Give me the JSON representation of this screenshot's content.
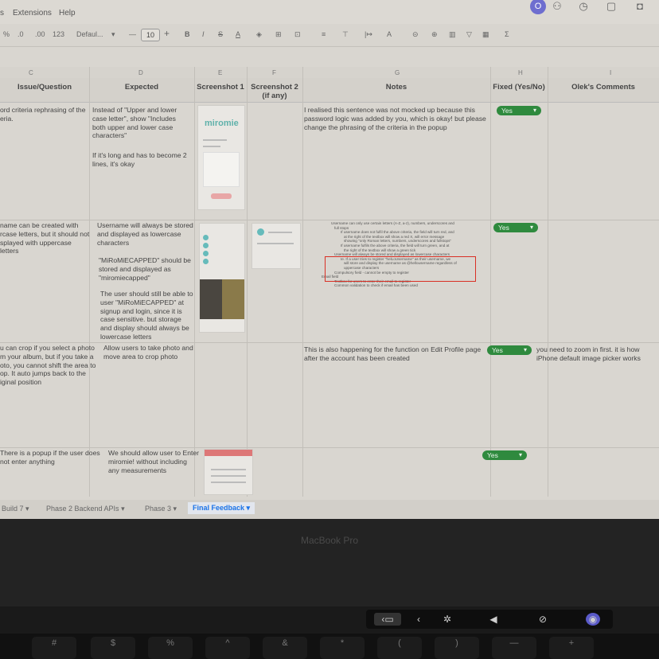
{
  "menu": {
    "extensions": "Extensions",
    "help": "Help",
    "partial": "s"
  },
  "header_icons": {
    "avatar_letter": "O"
  },
  "toolbar": {
    "percent": "%",
    "dec_less": ".0",
    "dec_more": ".00",
    "num_format": "123",
    "font": "Defaul...",
    "minus": "—",
    "font_size": "10",
    "plus": "+",
    "bold": "B",
    "italic": "I",
    "strike": "S",
    "color_a": "A",
    "sigma": "Σ"
  },
  "col_letters": [
    "C",
    "D",
    "E",
    "F",
    "G",
    "H",
    "I"
  ],
  "columns": {
    "issue": "Issue/Question",
    "expected": "Expected",
    "shot1": "Screenshot 1",
    "shot2": "Screenshot 2 (if any)",
    "notes": "Notes",
    "fixed": "Fixed (Yes/No)",
    "comments": "Olek's Comments"
  },
  "rows": [
    {
      "issue": "ord criteria rephrasing of the eria.",
      "expected": "Instead of \"Upper and lower case letter\", show \"Includes both upper and lower case characters\"",
      "expected2": "If it's long and has to become 2 lines, it's okay",
      "shot1_logo": "miromie",
      "notes": "I realised this sentence was not mocked up because this password logic was added by you, which is okay! but please change the phrasing of the criteria in the popup",
      "fixed": "Yes",
      "comment": ""
    },
    {
      "issue": "name can be created with rcase letters, but it should not splayed with uppercase letters",
      "expected": "Username will always be stored and displayed as lowercase characters",
      "expected2": "\"MiRoMiECAPPED\" should be stored and displayed as \"miromiecapped\"",
      "expected3": "The user should still be able to user \"MiRoMiECAPPED\" at signup and login, since it is case sensitive. but storage and display should always be lowercase letters",
      "notes_lines": [
        "Username can only use certain letters (A-Z, a-z), numbers, underscores and",
        "full stops",
        "If username does not fulfil the above criteria, the field will turn red, and",
        "at the right of the textbox will show a red X, will error message",
        "showing \"only Roman letters, numbers, underscores and fullstops\"",
        "If username fulfils the above criteria, the field will turn green, and at",
        "the right of the textbox will show a green tick",
        "Username will always be stored and displayed as lowercase characters",
        "Ie. If a user tries to register \"helLoUsername\" as their username, we",
        "will store and display the username as @hellousername regardless of",
        "uppercase characters",
        "Compulsory field - cannot be empty to register",
        "Email field",
        "Textbox for users to enter their email to register",
        "Common validation to check if email has been used"
      ],
      "fixed": "Yes",
      "comment": ""
    },
    {
      "issue": "u can crop if you select a photo m your album, but if you take a oto, you cannot shift the area to op. It auto jumps back to the iginal position",
      "expected": "Allow users to take photo and move area to crop photo",
      "notes": "This is also happening for the function on Edit Profile page after the account has been created",
      "fixed": "Yes",
      "comment": "you need to zoom in first. it is how iPhone default image picker works"
    },
    {
      "issue": "There is a popup if the user does not enter anything",
      "expected": "We should allow user to Enter miromie! without including any measurements",
      "notes": "",
      "fixed": "Yes",
      "comment": ""
    }
  ],
  "tabs": [
    "Build 7",
    "Phase 2 Backend APIs",
    "Phase 3",
    "Final Feedback"
  ],
  "laptop_label": "MacBook Pro",
  "keys": [
    "#",
    "$",
    "%",
    "^",
    "&",
    "*",
    "(",
    ")",
    "—",
    "+"
  ]
}
